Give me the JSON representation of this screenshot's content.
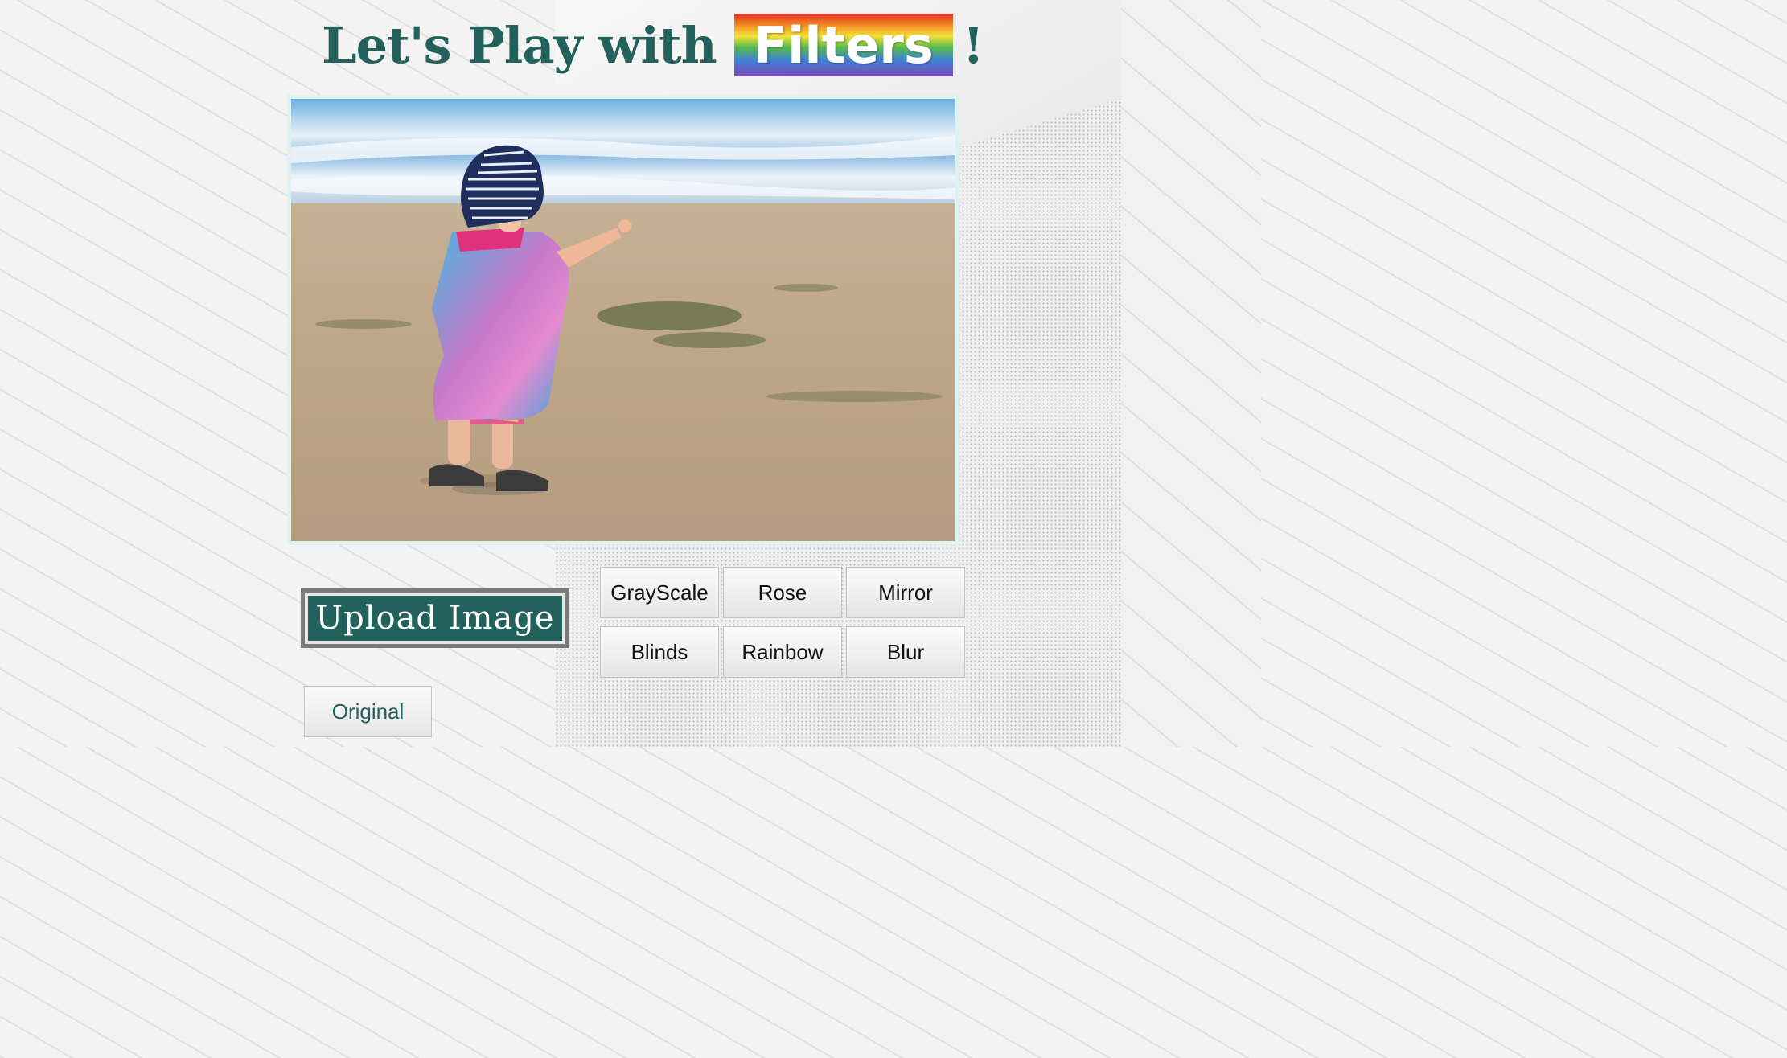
{
  "header": {
    "title_prefix": "Let's Play with",
    "title_highlight": "Filters",
    "title_suffix": "!"
  },
  "image": {
    "description_icon": "beach-photo"
  },
  "upload": {
    "label": "Upload Image"
  },
  "filters": [
    {
      "label": "GrayScale"
    },
    {
      "label": "Rose"
    },
    {
      "label": "Mirror"
    },
    {
      "label": "Blinds"
    },
    {
      "label": "Rainbow"
    },
    {
      "label": "Blur"
    }
  ],
  "original": {
    "label": "Original"
  },
  "colors": {
    "accent": "#23615d",
    "frame": "#dff2ef"
  }
}
